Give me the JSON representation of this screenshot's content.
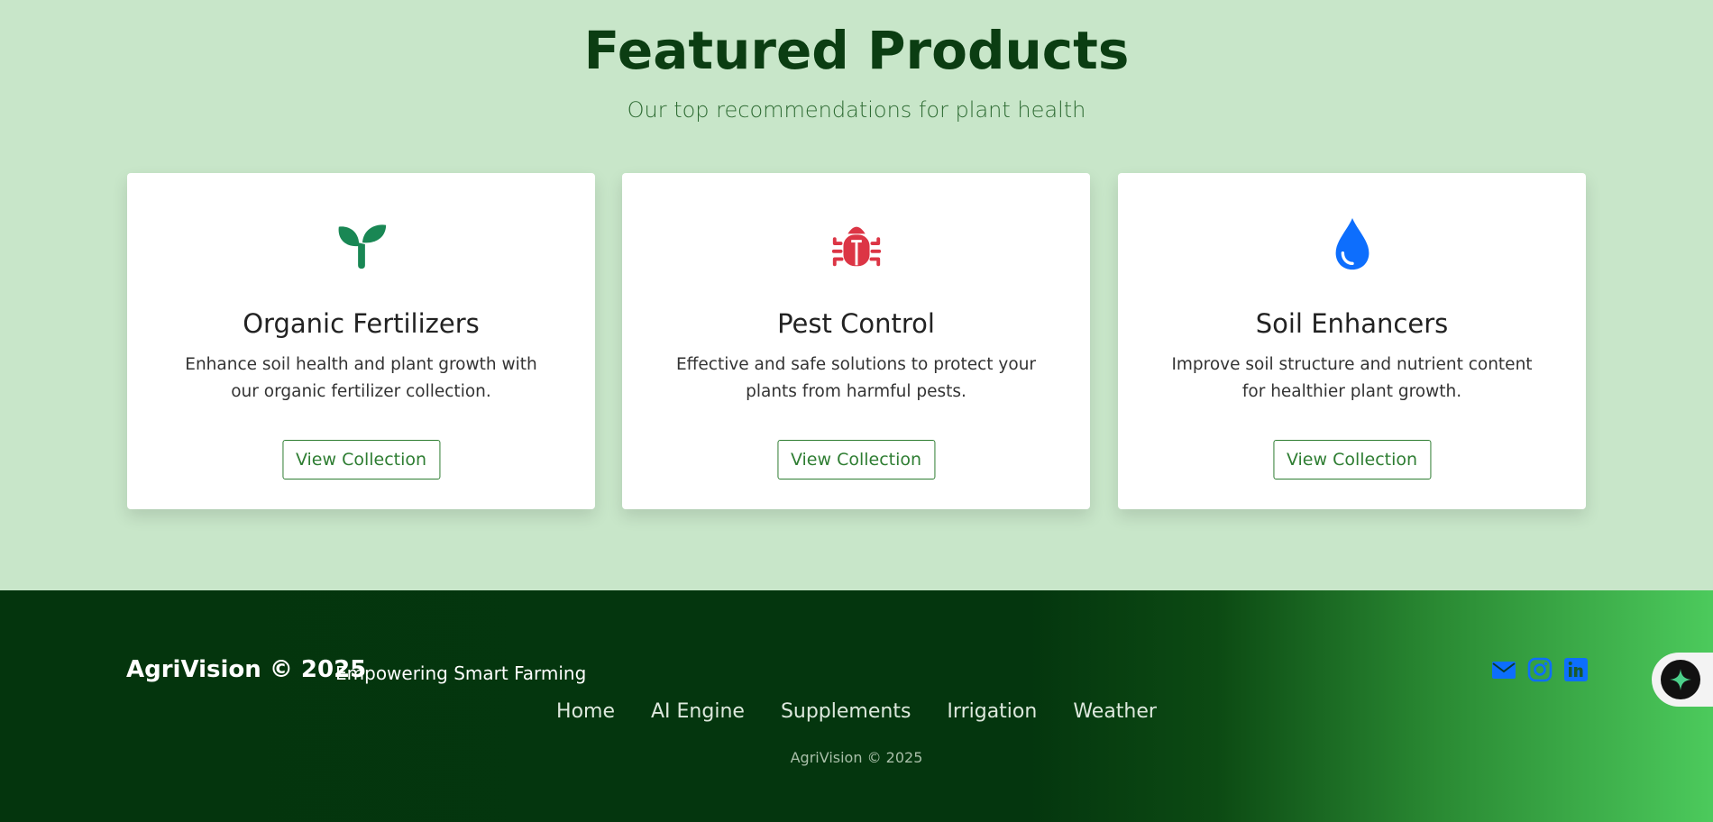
{
  "section": {
    "title": "Featured Products",
    "subtitle": "Our top recommendations for plant health"
  },
  "cards": [
    {
      "icon": "sprout-icon",
      "icon_color": "#198754",
      "title": "Organic Fertilizers",
      "description": "Enhance soil health and plant growth with our organic fertilizer collection.",
      "button": "View Collection"
    },
    {
      "icon": "bug-icon",
      "icon_color": "#dc3545",
      "title": "Pest Control",
      "description": "Effective and safe solutions to protect your plants from harmful pests.",
      "button": "View Collection"
    },
    {
      "icon": "water-drop-icon",
      "icon_color": "#0d6efd",
      "title": "Soil Enhancers",
      "description": "Improve soil structure and nutrient content for healthier plant growth.",
      "button": "View Collection"
    }
  ],
  "footer": {
    "brand": "AgriVision © 2025",
    "tagline": "Empowering Smart Farming",
    "nav": [
      "Home",
      "AI Engine",
      "Supplements",
      "Irrigation",
      "Weather"
    ],
    "copyright": "AgriVision © 2025",
    "social_icons": [
      "envelope-icon",
      "instagram-icon",
      "linkedin-icon"
    ],
    "social_color": "#0d6efd"
  },
  "colors": {
    "accent": "#2e7d32",
    "background": "#c8e6c9",
    "heading": "#0b3d12"
  }
}
